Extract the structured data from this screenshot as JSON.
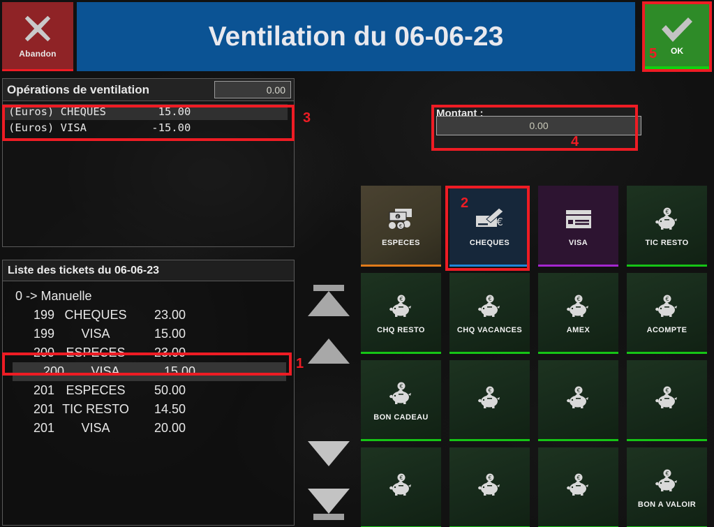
{
  "window": {
    "title": "Ventilation du 06-06-23"
  },
  "topbar": {
    "abandon_label": "Abandon",
    "abandon_icon": "close-x-icon",
    "ok_label": "OK",
    "ok_icon": "check-icon",
    "title_bar_color": "#0b5394",
    "abandon_color": "#8f2326",
    "ok_color": "#2e8b28"
  },
  "markers": {
    "m1": "1",
    "m2": "2",
    "m3": "3",
    "m4": "4",
    "m5": "5",
    "color": "#ee1c24"
  },
  "operations": {
    "header": "Opérations de ventilation",
    "total": "0.00",
    "rows": [
      {
        "currency": "(Euros)",
        "mode": "CHEQUES",
        "amount": "15.00",
        "text": "(Euros) CHEQUES        15.00",
        "selected": true
      },
      {
        "currency": "(Euros)",
        "mode": "VISA",
        "amount": "-15.00",
        "text": "(Euros) VISA          -15.00",
        "selected": false
      }
    ]
  },
  "tickets": {
    "header": "Liste des tickets du 06-06-23",
    "group_label": "0 -> Manuelle",
    "rows": [
      {
        "num": "199",
        "mode": "CHEQUES",
        "amount": "23.00",
        "selected": false
      },
      {
        "num": "199",
        "mode": "VISA",
        "amount": "15.00",
        "selected": false
      },
      {
        "num": "200",
        "mode": "ESPECES",
        "amount": "23.00",
        "selected": false
      },
      {
        "num": "200",
        "mode": "VISA",
        "amount": "15.00",
        "selected": true
      },
      {
        "num": "201",
        "mode": "ESPECES",
        "amount": "50.00",
        "selected": false
      },
      {
        "num": "201",
        "mode": "TIC RESTO",
        "amount": "14.50",
        "selected": false
      },
      {
        "num": "201",
        "mode": "VISA",
        "amount": "20.00",
        "selected": false
      }
    ]
  },
  "scroller": {
    "top_label": "scroll-first",
    "up_label": "scroll-up",
    "down_label": "scroll-down",
    "bottom_label": "scroll-last"
  },
  "montant": {
    "label": "Montant :",
    "value": "0.00"
  },
  "tiles": [
    {
      "label": "ESPECES",
      "icon": "banknote-coins-icon",
      "style": "especes",
      "accent": "#e07b1a",
      "highlighted": false
    },
    {
      "label": "CHEQUES",
      "icon": "cheque-pen-icon",
      "style": "cheques",
      "accent": "#1f86d8",
      "highlighted": true
    },
    {
      "label": "VISA",
      "icon": "credit-card-icon",
      "style": "visa",
      "accent": "#a426cf",
      "highlighted": false
    },
    {
      "label": "TIC RESTO",
      "icon": "piggy-bank-icon",
      "style": "green",
      "accent": "#16c416",
      "highlighted": false
    },
    {
      "label": "CHQ RESTO",
      "icon": "piggy-bank-icon",
      "style": "green",
      "accent": "#16c416",
      "highlighted": false
    },
    {
      "label": "CHQ VACANCES",
      "icon": "piggy-bank-icon",
      "style": "green",
      "accent": "#16c416",
      "highlighted": false
    },
    {
      "label": "AMEX",
      "icon": "piggy-bank-icon",
      "style": "green",
      "accent": "#16c416",
      "highlighted": false
    },
    {
      "label": "ACOMPTE",
      "icon": "piggy-bank-icon",
      "style": "green",
      "accent": "#16c416",
      "highlighted": false
    },
    {
      "label": "BON CADEAU",
      "icon": "piggy-bank-icon",
      "style": "green",
      "accent": "#16c416",
      "highlighted": false
    },
    {
      "label": "",
      "icon": "piggy-bank-icon",
      "style": "green",
      "accent": "#16c416",
      "highlighted": false
    },
    {
      "label": "",
      "icon": "piggy-bank-icon",
      "style": "green",
      "accent": "#16c416",
      "highlighted": false
    },
    {
      "label": "",
      "icon": "piggy-bank-icon",
      "style": "green",
      "accent": "#16c416",
      "highlighted": false
    },
    {
      "label": "",
      "icon": "piggy-bank-icon",
      "style": "green",
      "accent": "#16c416",
      "highlighted": false
    },
    {
      "label": "",
      "icon": "piggy-bank-icon",
      "style": "green",
      "accent": "#16c416",
      "highlighted": false
    },
    {
      "label": "",
      "icon": "piggy-bank-icon",
      "style": "green",
      "accent": "#16c416",
      "highlighted": false
    },
    {
      "label": "BON A VALOIR",
      "icon": "piggy-bank-icon",
      "style": "green",
      "accent": "#16c416",
      "highlighted": false
    }
  ]
}
